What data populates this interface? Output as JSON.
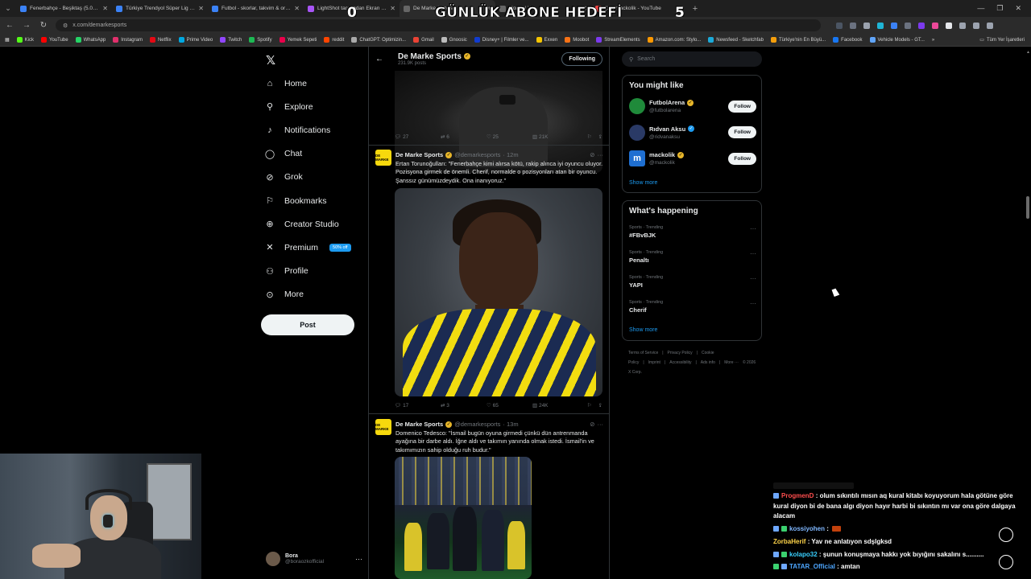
{
  "browser": {
    "tabs": [
      {
        "title": "Fenerbahçe - Beşiktaş (5.04.20",
        "color": "#3b82f6",
        "active": false
      },
      {
        "title": "Türkiye Trendyol Süper Lig - 20",
        "color": "#3b82f6",
        "active": false
      },
      {
        "title": "Futbol - skorlar, takvim & oran",
        "color": "#3b82f6",
        "active": false
      },
      {
        "title": "LightShot tarafından Ekran Gö",
        "color": "#a855f7",
        "active": false
      },
      {
        "title": "De Marke Sports",
        "color": "#666666",
        "active": true
      },
      {
        "title": "Home / X",
        "color": "#666666",
        "active": false
      },
      {
        "title": "(30) mackolik - YouTube",
        "color": "#ef4444",
        "active": false
      }
    ],
    "url": "x.com/demarkesports",
    "bookmarks": [
      {
        "label": "Kick",
        "color": "#53fc18"
      },
      {
        "label": "YouTube",
        "color": "#ff0000"
      },
      {
        "label": "WhatsApp",
        "color": "#25d366"
      },
      {
        "label": "Instagram",
        "color": "#e1306c"
      },
      {
        "label": "Netflix",
        "color": "#e50914"
      },
      {
        "label": "Prime Video",
        "color": "#00a8e1"
      },
      {
        "label": "Twitch",
        "color": "#9146ff"
      },
      {
        "label": "Spotify",
        "color": "#1db954"
      },
      {
        "label": "Yemek Sepeti",
        "color": "#ea004b"
      },
      {
        "label": "reddit",
        "color": "#ff4500"
      },
      {
        "label": "ChatGPT: Optimizin...",
        "color": "#aaaaaa"
      },
      {
        "label": "Gmail",
        "color": "#ea4335"
      },
      {
        "label": "Gnoosic",
        "color": "#bbbbbb"
      },
      {
        "label": "Disney+ | Filmler ve...",
        "color": "#113ccf"
      },
      {
        "label": "Exxen",
        "color": "#f5c400"
      },
      {
        "label": "Moobot",
        "color": "#f97316"
      },
      {
        "label": "StreamElements",
        "color": "#7c3aed"
      },
      {
        "label": "Amazon.com: Stylo...",
        "color": "#ff9900"
      },
      {
        "label": "Newsfeed - Sketchfab",
        "color": "#1caad9"
      },
      {
        "label": "Türkiye'nin En Büyü...",
        "color": "#f59e0b"
      },
      {
        "label": "Facebook",
        "color": "#1877f2"
      },
      {
        "label": "Vehicle Models - GT...",
        "color": "#60a5fa"
      }
    ],
    "bookmarks_more": "»",
    "all_bookmarks": "Tüm Yer İşaretleri"
  },
  "stream_overlay": {
    "goal_title": "GÜNLÜK ABONE HEDEFİ",
    "current": "0",
    "target": "5"
  },
  "nav": {
    "items": [
      {
        "label": "Home",
        "icon": "home-icon",
        "glyph": "⌂"
      },
      {
        "label": "Explore",
        "icon": "search-icon",
        "glyph": "⚲"
      },
      {
        "label": "Notifications",
        "icon": "bell-icon",
        "glyph": "♪"
      },
      {
        "label": "Chat",
        "icon": "chat-icon",
        "glyph": "◯"
      },
      {
        "label": "Grok",
        "icon": "grok-icon",
        "glyph": "⊘"
      },
      {
        "label": "Bookmarks",
        "icon": "bookmark-icon",
        "glyph": "⚐"
      },
      {
        "label": "Creator Studio",
        "icon": "creator-studio-icon",
        "glyph": "⊕"
      },
      {
        "label": "Premium",
        "icon": "x-premium-icon",
        "glyph": "✕"
      },
      {
        "label": "Profile",
        "icon": "profile-icon",
        "glyph": "⚇"
      },
      {
        "label": "More",
        "icon": "more-icon",
        "glyph": "⊙"
      }
    ],
    "premium_badge": "50% off",
    "post_button": "Post",
    "account_name": "Bora",
    "account_handle": "@boraozkofficial"
  },
  "profile": {
    "name": "De Marke Sports",
    "posts_count": "231.9K posts",
    "following_button": "Following"
  },
  "first_post_actions": {
    "replies": "27",
    "reposts": "6",
    "likes": "25",
    "views": "21K"
  },
  "tweets": [
    {
      "avatar_text": "DE MARKE",
      "name": "De Marke Sports",
      "handle": "@demarkesports",
      "time": "· 12m",
      "text": "Ertan Torunoğulları: \"Fenerbahçe kimi alırsa kötü, rakip alınca iyi oyuncu oluyor. Pozisyona girmek de önemli. Cherif, normalde o pozisyonları atan bir oyuncu. Şanssız günümüzdeydik. Ona inanıyoruz.\"",
      "replies": "17",
      "reposts": "3",
      "likes": "65",
      "views": "24K"
    },
    {
      "avatar_text": "DE MARKE",
      "name": "De Marke Sports",
      "handle": "@demarkesports",
      "time": "· 13m",
      "text": "Domenico Tedesco: \"İsmail bugün oyuna girmedi çünkü dün antrenmanda ayağına bir darbe aldı. İğne aldı ve takımın yanında olmak istedi. İsmail'in ve takımımızın sahip olduğu ruh budur.\""
    }
  ],
  "search": {
    "placeholder": "Search"
  },
  "you_might_like": {
    "title": "You might like",
    "accounts": [
      {
        "name": "FutbolArena",
        "handle": "@futbolarena",
        "verified": "gold",
        "avatar_color": "#1f8a3a",
        "follow": "Follow"
      },
      {
        "name": "Rıdvan Aksu",
        "handle": "@ridvanaksu",
        "verified": "blue",
        "avatar_color": "#2a3a66",
        "follow": "Follow"
      },
      {
        "name": "mackolik",
        "handle": "@mackolik",
        "verified": "gold",
        "avatar_color": "#1f6fd1",
        "follow": "Follow"
      }
    ],
    "show_more": "Show more"
  },
  "whats_happening": {
    "title": "What's happening",
    "trends": [
      {
        "category": "Sports · Trending",
        "topic": "#FBvBJK"
      },
      {
        "category": "Sports · Trending",
        "topic": "Penaltı"
      },
      {
        "category": "Sports · Trending",
        "topic": "YAPI"
      },
      {
        "category": "Sports · Trending",
        "topic": "Cherif"
      }
    ],
    "show_more": "Show more"
  },
  "footer_links": [
    "Terms of Service",
    "|",
    "Privacy Policy",
    "|",
    "Cookie Policy",
    "|",
    "Imprint",
    "|",
    "Accessibility",
    "|",
    "Ads info",
    "|",
    "More ···",
    "© 2026 X Corp."
  ],
  "chat": {
    "messages": [
      {
        "user": "ProgmenD",
        "user_color": "#ff4d4d",
        "text": ": olum sıkıntılı mısın aq kural kitabı koyuyorum hala götüne göre kural diyon bi de bana algı diyon hayır harbi bi sıkıntın mı var ona göre dalgaya alacam",
        "badges": [
          "#6ea8ff"
        ]
      },
      {
        "user": "kossiyohen",
        "user_color": "#7fb7ff",
        "text": ":",
        "badges": [
          "#6ea8ff",
          "#3bd16f"
        ]
      },
      {
        "user": "ZorbaHerif",
        "user_color": "#ffd54a",
        "text": ": Yav ne anlatıyon sdşlgksd",
        "badges": []
      },
      {
        "user": "kolapo32",
        "user_color": "#39d0ff",
        "text": ": şunun konuşmaya hakkı yok bıyığını sakalını s..........",
        "badges": [
          "#6ea8ff",
          "#3bd16f"
        ]
      },
      {
        "user": "TATAR_Official",
        "user_color": "#4da6ff",
        "text": ": amtan",
        "badges": [
          "#3bd16f",
          "#6ea8ff"
        ]
      }
    ]
  }
}
